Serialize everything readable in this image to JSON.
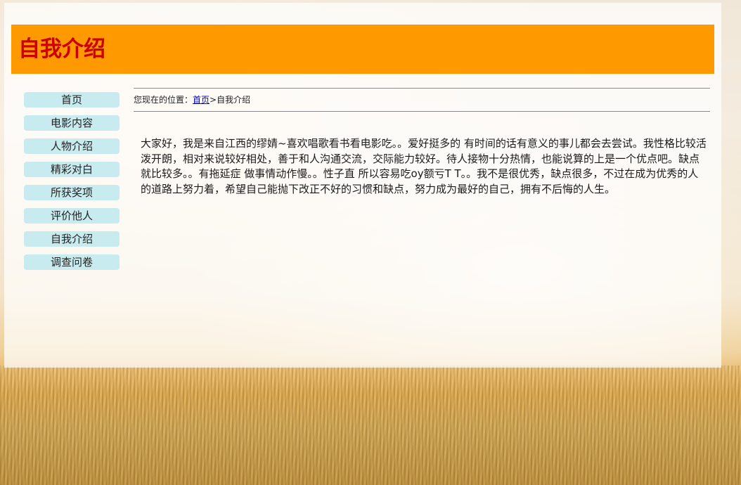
{
  "page": {
    "title": "自我介绍"
  },
  "nav": {
    "items": [
      {
        "label": "首页"
      },
      {
        "label": "电影内容"
      },
      {
        "label": "人物介绍"
      },
      {
        "label": "精彩对白"
      },
      {
        "label": "所获奖项"
      },
      {
        "label": "评价他人"
      },
      {
        "label": "自我介绍"
      },
      {
        "label": "调查问卷"
      }
    ]
  },
  "breadcrumb": {
    "prefix": "您现在的位置：",
    "home_link": "首页",
    "separator": ">",
    "current": "自我介绍"
  },
  "content": {
    "body": "大家好，我是来自江西的缪婧~喜欢唱歌看书看电影吃。。爱好挺多的 有时间的话有意义的事儿都会去尝试。我性格比较活泼开朗，相对来说较好相处，善于和人沟通交流，交际能力较好。待人接物十分热情，也能说算的上是一个优点吧。缺点就比较多。。有拖延症 做事情动作慢。。性子直 所以容易吃oy额亏T T。。我不是很优秀，缺点很多，不过在成为优秀的人的道路上努力着，希望自己能抛下改正不好的习惯和缺点，努力成为最好的自己，拥有不后悔的人生。"
  },
  "colors": {
    "header_bg": "#ff9900",
    "title_color": "#cc0000",
    "nav_bg": "#c8ebef",
    "link_color": "#0000cc"
  }
}
